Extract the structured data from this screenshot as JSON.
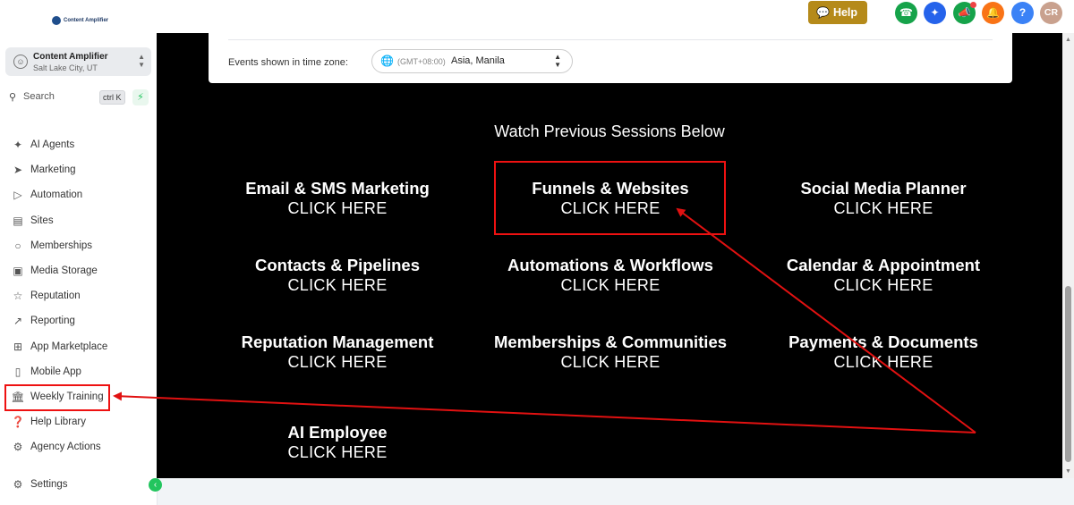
{
  "brand": {
    "logo_text": "Content Amplifier"
  },
  "location": {
    "name": "Content Amplifier",
    "city": "Salt Lake City, UT"
  },
  "search": {
    "label": "Search",
    "shortcut": "ctrl K"
  },
  "nav": [
    {
      "label": "AI Agents",
      "icon": "sparkle-icon"
    },
    {
      "label": "Marketing",
      "icon": "send-icon"
    },
    {
      "label": "Automation",
      "icon": "play-circle-icon"
    },
    {
      "label": "Sites",
      "icon": "sites-icon"
    },
    {
      "label": "Memberships",
      "icon": "award-icon"
    },
    {
      "label": "Media Storage",
      "icon": "image-icon"
    },
    {
      "label": "Reputation",
      "icon": "star-icon"
    },
    {
      "label": "Reporting",
      "icon": "trend-icon"
    },
    {
      "label": "App Marketplace",
      "icon": "grid-icon"
    },
    {
      "label": "Mobile App",
      "icon": "phone-icon"
    },
    {
      "label": "Weekly Training",
      "icon": "bank-icon"
    },
    {
      "label": "Help Library",
      "icon": "question-icon"
    },
    {
      "label": "Agency Actions",
      "icon": "network-icon"
    }
  ],
  "settings_label": "Settings",
  "header": {
    "help_label": "Help",
    "avatar_initials": "CR",
    "colors": {
      "help": "#b58a1a",
      "phone": "#16a34a",
      "magic": "#2563eb",
      "announce": "#16a34a",
      "bell": "#f97316",
      "question": "#3b82f6",
      "avatar": "#c9a18e"
    }
  },
  "timezone": {
    "label": "Events shown in time zone:",
    "offset": "(GMT+08:00)",
    "city": "Asia, Manila"
  },
  "main": {
    "heading": "Watch Previous Sessions Below",
    "sessions": [
      {
        "title": "Email & SMS Marketing",
        "cta": "CLICK HERE"
      },
      {
        "title": "Funnels & Websites",
        "cta": "CLICK HERE"
      },
      {
        "title": "Social Media Planner",
        "cta": "CLICK HERE"
      },
      {
        "title": "Contacts & Pipelines",
        "cta": "CLICK HERE"
      },
      {
        "title": "Automations & Workflows",
        "cta": "CLICK HERE"
      },
      {
        "title": "Calendar & Appointment",
        "cta": "CLICK HERE"
      },
      {
        "title": "Reputation Management",
        "cta": "CLICK HERE"
      },
      {
        "title": "Memberships & Communities",
        "cta": "CLICK HERE"
      },
      {
        "title": "Payments & Documents",
        "cta": "CLICK HERE"
      },
      {
        "title": "AI Employee",
        "cta": "CLICK HERE"
      }
    ]
  },
  "annotation_color": "#e11111"
}
